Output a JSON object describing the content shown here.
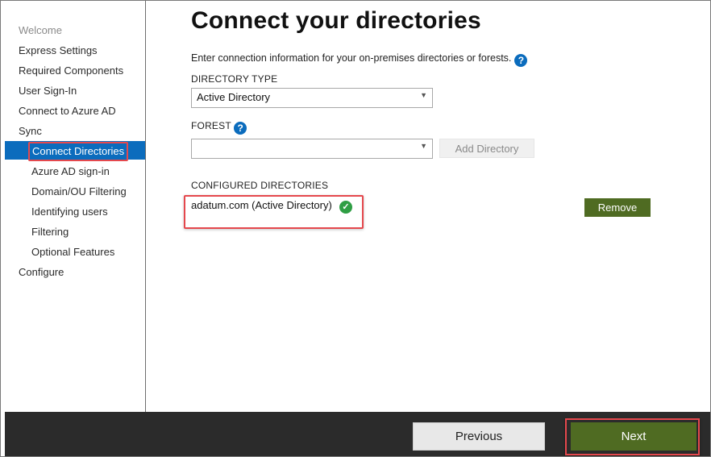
{
  "sidebar": {
    "items": [
      {
        "label": "Welcome",
        "state": "disabled"
      },
      {
        "label": "Express Settings"
      },
      {
        "label": "Required Components"
      },
      {
        "label": "User Sign-In"
      },
      {
        "label": "Connect to Azure AD"
      },
      {
        "label": "Sync"
      },
      {
        "label": "Connect Directories",
        "state": "active"
      },
      {
        "label": "Azure AD sign-in"
      },
      {
        "label": "Domain/OU Filtering"
      },
      {
        "label": "Identifying users"
      },
      {
        "label": "Filtering"
      },
      {
        "label": "Optional Features"
      },
      {
        "label": "Configure"
      }
    ]
  },
  "main": {
    "title": "Connect your directories",
    "intro": "Enter connection information for your on-premises directories or forests.",
    "help_glyph": "?",
    "directory_type": {
      "label": "DIRECTORY TYPE",
      "value": "Active Directory"
    },
    "forest": {
      "label": "FOREST",
      "value": ""
    },
    "add_directory_label": "Add Directory",
    "configured": {
      "label": "CONFIGURED DIRECTORIES",
      "items": [
        {
          "name": "adatum.com (Active Directory)",
          "status": "connected"
        }
      ],
      "remove_label": "Remove"
    }
  },
  "footer": {
    "previous_label": "Previous",
    "next_label": "Next"
  },
  "colors": {
    "accent_blue": "#0b6cbd",
    "primary_green": "#4f6b22",
    "highlight_red": "#e5484d",
    "footer_bg": "#2b2b2b",
    "success_green": "#2f9e44"
  }
}
